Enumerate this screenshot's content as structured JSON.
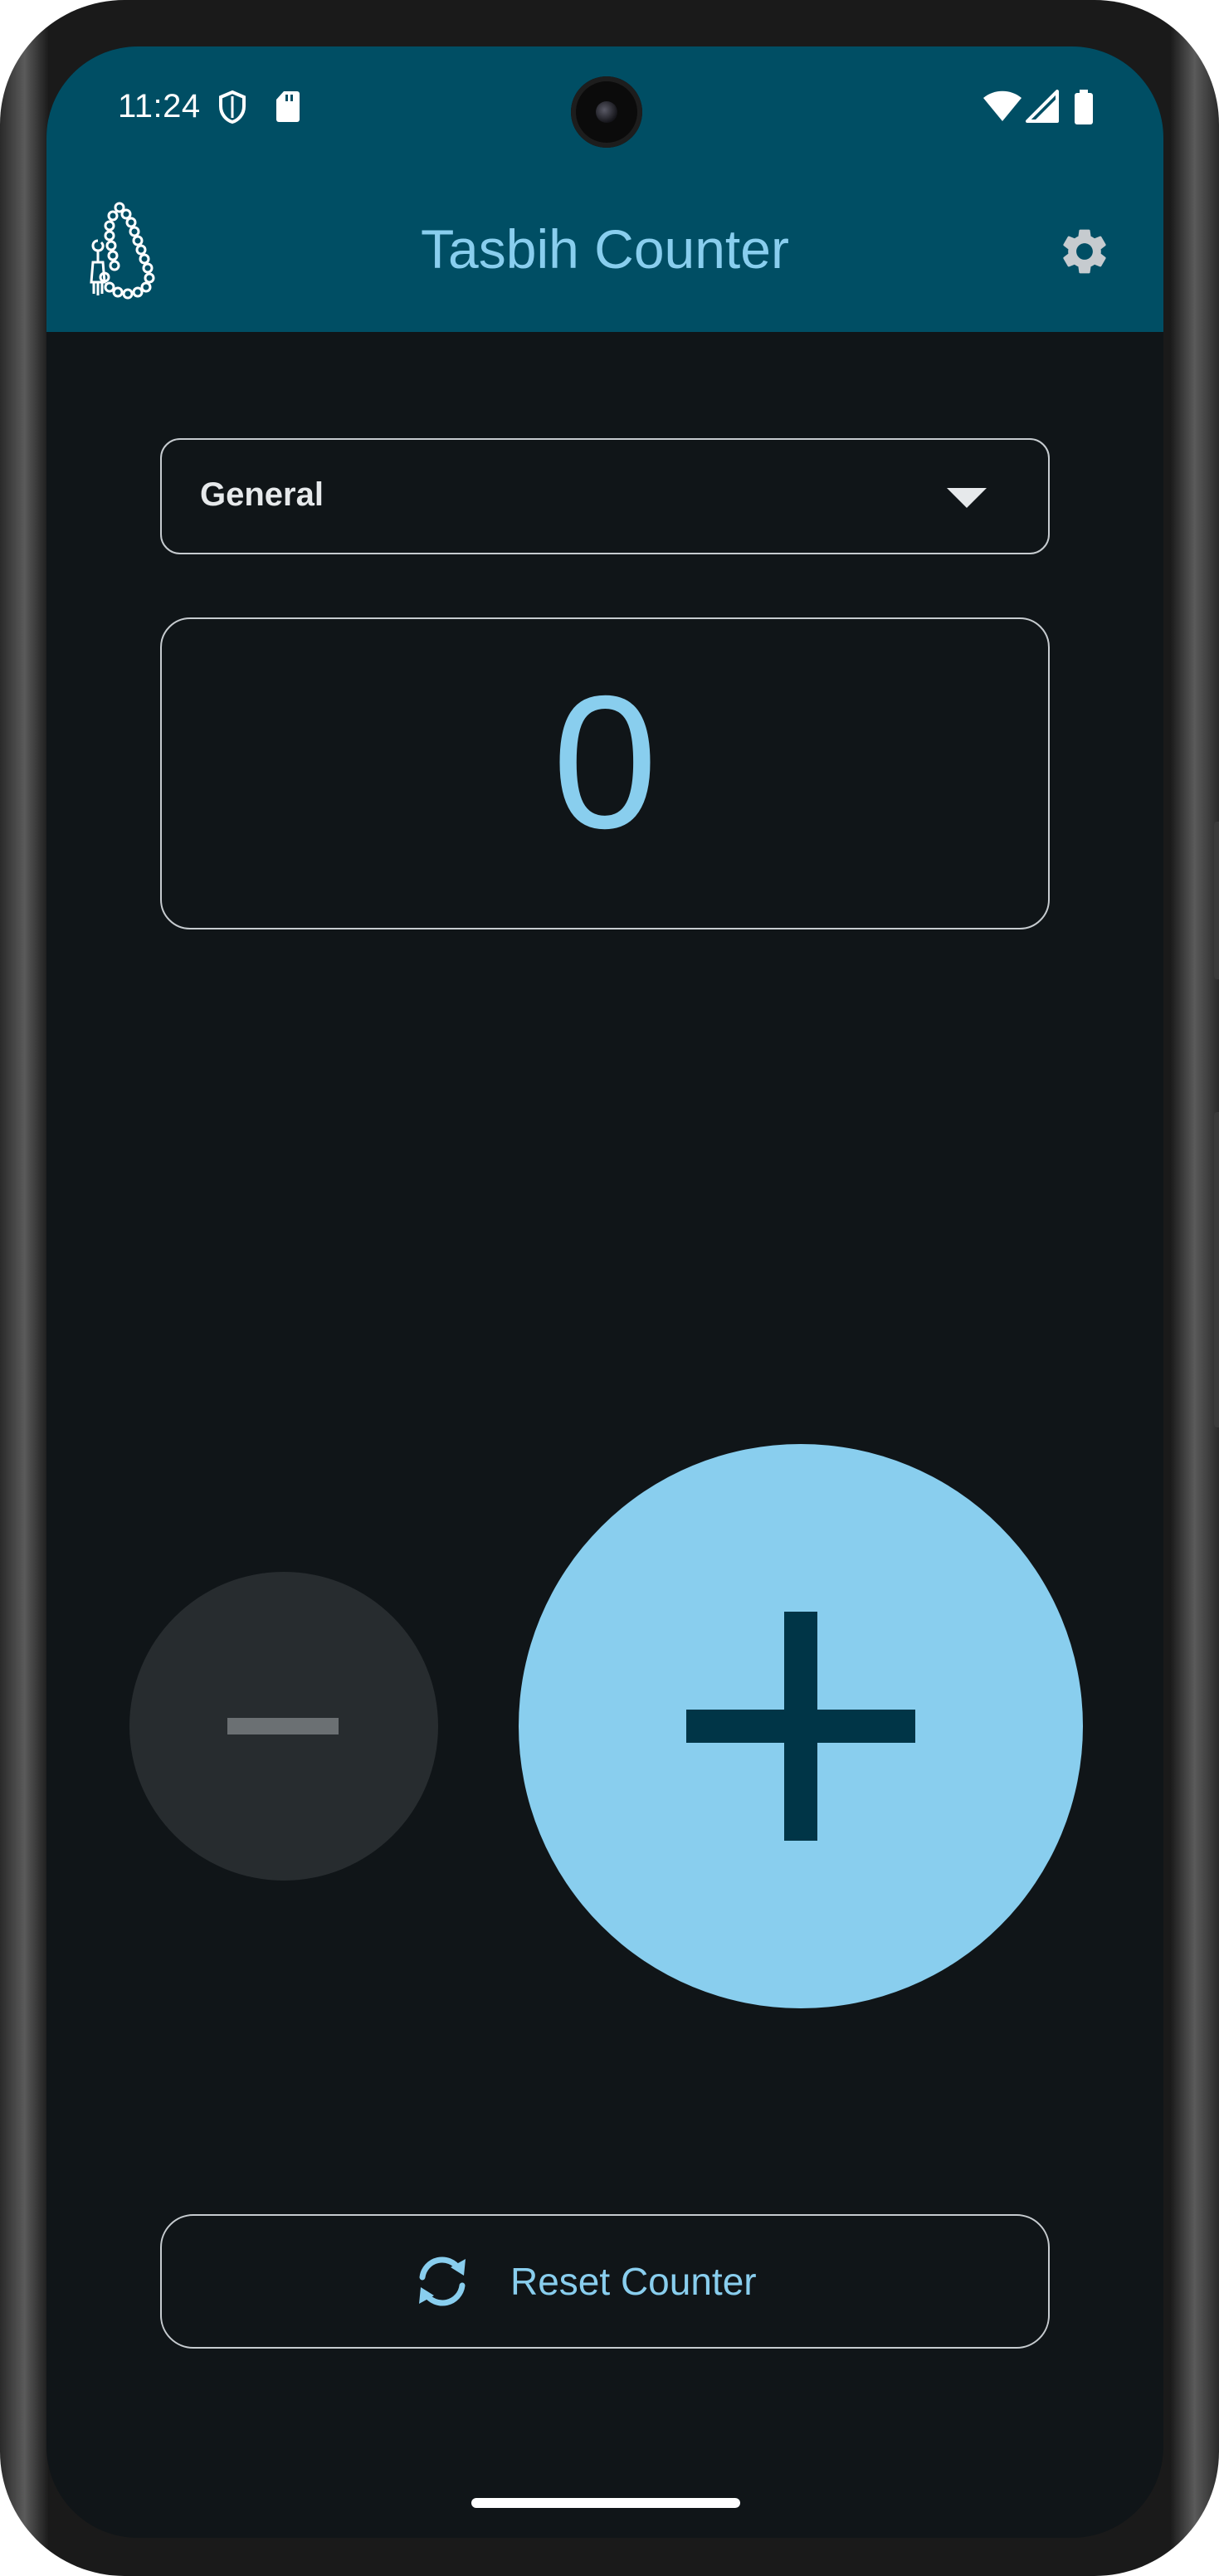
{
  "status_bar": {
    "time": "11:24",
    "icons": [
      "shield-icon",
      "sd-card-icon",
      "wifi-icon",
      "signal-icon",
      "battery-icon"
    ]
  },
  "app_bar": {
    "title": "Tasbih Counter",
    "logo": "prayer-beads-icon",
    "settings_icon": "gear-icon"
  },
  "dhikr_select": {
    "selected": "General"
  },
  "counter": {
    "value": "0"
  },
  "controls": {
    "decrement_icon": "minus-icon",
    "increment_icon": "plus-icon"
  },
  "reset": {
    "label": "Reset Counter",
    "icon": "refresh-icon"
  },
  "colors": {
    "app_bar": "#004e64",
    "background": "#101518",
    "accent": "#89ceee",
    "on_accent": "#003547",
    "disabled_button": "#272c2f"
  }
}
